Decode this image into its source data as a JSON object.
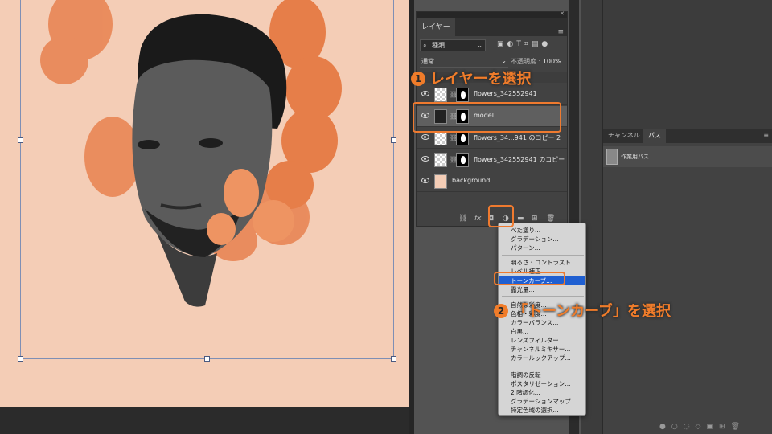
{
  "layers_panel": {
    "tab_label": "レイヤー",
    "close_glyph": "✕",
    "kind_filter": "種類",
    "blend_mode": "通常",
    "opacity_label": "不透明度 :",
    "opacity_value": "100%",
    "layers": [
      {
        "name": "flowers_342552941",
        "visible": true
      },
      {
        "name": "model",
        "visible": true,
        "selected": true
      },
      {
        "name": "flowers_34...941 のコピー 2",
        "visible": true
      },
      {
        "name": "flowers_342552941 のコピー",
        "visible": true
      },
      {
        "name": "background",
        "visible": true
      }
    ],
    "footer_fx": "fx"
  },
  "channels_panel": {
    "tabs": [
      "チャンネル",
      "パス"
    ],
    "active_tab": "パス",
    "path_name": "作業用パス"
  },
  "adjustment_menu": {
    "items": [
      "べた塗り...",
      "グラデーション...",
      "パターン...",
      "明るさ・コントラスト...",
      "レベル補正...",
      "トーンカーブ...",
      "露光量...",
      "自然な彩度...",
      "色相・彩度...",
      "カラーバランス...",
      "白黒...",
      "レンズフィルター...",
      "チャンネルミキサー...",
      "カラールックアップ...",
      "階調の反転",
      "ポスタリゼーション...",
      "2 階調化...",
      "グラデーションマップ...",
      "特定色域の選択..."
    ],
    "highlighted": "トーンカーブ..."
  },
  "annotations": {
    "step1_num": "1",
    "step1_text": "レイヤーを選択",
    "step2_num": "2",
    "step2_text": "「トーンカーブ」を選択",
    "accent_color": "#f07c2a"
  }
}
